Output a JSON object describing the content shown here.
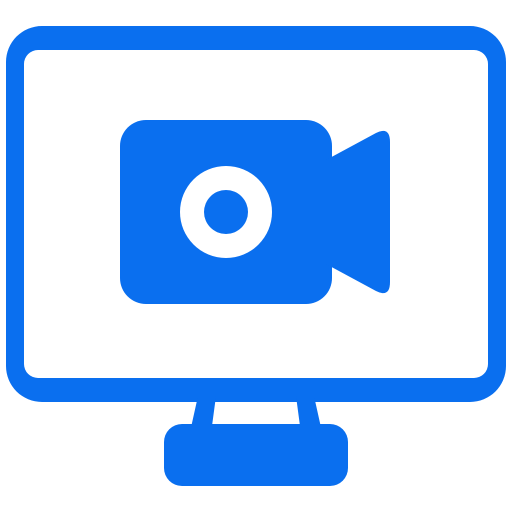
{
  "icon": {
    "name": "monitor-video-camera-icon",
    "accent_color": "#0A6FEF",
    "background_color": "#FFFFFF"
  }
}
